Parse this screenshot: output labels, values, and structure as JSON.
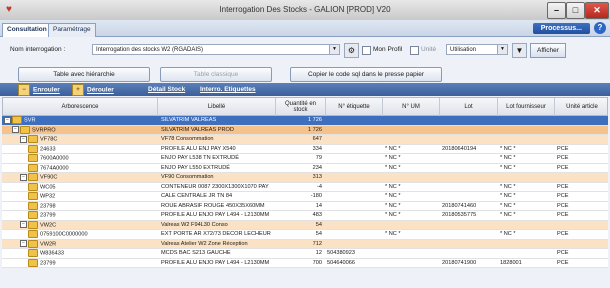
{
  "window": {
    "title": "Interrogation Des Stocks - GALION [PROD] V20"
  },
  "tabs": [
    {
      "label": "Consultation"
    },
    {
      "label": "Paramétrage"
    }
  ],
  "processus_label": "Processus...",
  "toolbar": {
    "nom_label": "Nom interrogation :",
    "nom_value": "Interrogation des stocks W2 (RGADAIS)",
    "mon_profil_label": "Mon Profil",
    "unite_label": "Unité",
    "unite_value": "Utilisation",
    "afficher_label": "Afficher"
  },
  "view_buttons": {
    "hierarchie": "Table avec hiérarchie",
    "classique": "Table classique",
    "copier": "Copier le code sql dans le presse papier"
  },
  "links": {
    "enrouler": "Enrouler",
    "derouler": "Dérouler",
    "detail": "Détail Stock",
    "interro": "Interro. Etiquettes"
  },
  "columns": {
    "arbo": "Arborescence",
    "libelle": "Libellé",
    "qte_line1": "Quantité en",
    "qte_line2": "stock",
    "etiquette": "N° étiquette",
    "um": "N° UM",
    "lot": "Lot",
    "lot_fourn": "Lot fournisseur",
    "unite": "Unité article"
  },
  "rows": [
    {
      "level": 0,
      "arbo": "SVR",
      "libelle": "SILVATRIM VALREAS",
      "qte": "1 726",
      "etiquette": "",
      "um": "",
      "lot": "",
      "lot_fourn": "",
      "unite": ""
    },
    {
      "level": 1,
      "arbo": "SVRPRO",
      "libelle": "SILVATRIM VALREAS PROD",
      "qte": "1 726",
      "etiquette": "",
      "um": "",
      "lot": "",
      "lot_fourn": "",
      "unite": ""
    },
    {
      "level": 2,
      "arbo": "VF78C",
      "libelle": "VF78 Consommation",
      "qte": "647",
      "etiquette": "",
      "um": "",
      "lot": "",
      "lot_fourn": "",
      "unite": ""
    },
    {
      "level": 3,
      "arbo": "24633",
      "libelle": "PROFILE ALU ENJ PAY X540",
      "qte": "334",
      "etiquette": "",
      "um": "* NC *",
      "lot": "20180640194",
      "lot_fourn": "* NC *",
      "unite": "PCE"
    },
    {
      "level": 3,
      "arbo": "7600A0000",
      "libelle": "ENJO PAY L538 TN EXTRUDÉ",
      "qte": "79",
      "etiquette": "",
      "um": "* NC *",
      "lot": "",
      "lot_fourn": "* NC *",
      "unite": "PCE"
    },
    {
      "level": 3,
      "arbo": "7674A0000",
      "libelle": "ENJO PAY L550 EXTRUDÉ",
      "qte": "234",
      "etiquette": "",
      "um": "* NC *",
      "lot": "",
      "lot_fourn": "* NC *",
      "unite": "PCE"
    },
    {
      "level": 2,
      "arbo": "VF90C",
      "libelle": "VF90 Consommation",
      "qte": "313",
      "etiquette": "",
      "um": "",
      "lot": "",
      "lot_fourn": "",
      "unite": ""
    },
    {
      "level": 3,
      "arbo": "WC05",
      "libelle": "CONTENEUR 0087 2300X1300X1070 PAY",
      "qte": "-4",
      "etiquette": "",
      "um": "* NC *",
      "lot": "",
      "lot_fourn": "* NC *",
      "unite": "PCE"
    },
    {
      "level": 3,
      "arbo": "WP32",
      "libelle": "CALE CENTRALE JR TN 84",
      "qte": "-180",
      "etiquette": "",
      "um": "* NC *",
      "lot": "",
      "lot_fourn": "* NC *",
      "unite": "PCE"
    },
    {
      "level": 3,
      "arbo": "23798",
      "libelle": "ROUE ABRASIF ROUGE 450X35X60MM",
      "qte": "14",
      "etiquette": "",
      "um": "* NC *",
      "lot": "20180741460",
      "lot_fourn": "* NC *",
      "unite": "PCE"
    },
    {
      "level": 3,
      "arbo": "23799",
      "libelle": "PROFILE ALU ENJO PAY L494 - L2130MM",
      "qte": "483",
      "etiquette": "",
      "um": "* NC *",
      "lot": "20180535775",
      "lot_fourn": "* NC *",
      "unite": "PCE"
    },
    {
      "level": 2,
      "arbo": "VW2C",
      "libelle": "Valreas W2 F94L30 Conso",
      "qte": "54",
      "etiquette": "",
      "um": "",
      "lot": "",
      "lot_fourn": "",
      "unite": ""
    },
    {
      "level": 3,
      "arbo": "0759100C0000000",
      "libelle": "EXT PORTE AR X72/73 DECOR LECHEUR",
      "qte": "54",
      "etiquette": "",
      "um": "* NC *",
      "lot": "",
      "lot_fourn": "* NC *",
      "unite": "PCE"
    },
    {
      "level": 2,
      "arbo": "VW2R",
      "libelle": "Valreas Atelier W2 Zone Réception",
      "qte": "712",
      "etiquette": "",
      "um": "",
      "lot": "",
      "lot_fourn": "",
      "unite": ""
    },
    {
      "level": 3,
      "arbo": "W836433",
      "libelle": "MCDS BAC S213 GAUCHE",
      "qte": "12",
      "etiquette": "504380923",
      "um": "",
      "lot": "",
      "lot_fourn": "",
      "unite": "PCE"
    },
    {
      "level": 3,
      "arbo": "23799",
      "libelle": "PROFILE ALU ENJO PAY L494 - L2130MM",
      "qte": "700",
      "etiquette": "504640066",
      "um": "",
      "lot": "20180741900",
      "lot_fourn": "1828001",
      "unite": "PCE"
    }
  ]
}
